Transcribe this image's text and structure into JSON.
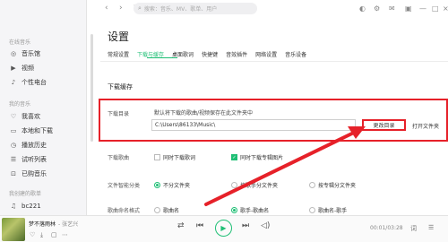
{
  "topbar": {
    "back_icon": "left-arrow-icon",
    "forward_icon": "right-arrow-icon",
    "search_placeholder": "搜索：音乐、MV、歌单、用户"
  },
  "sidebar": {
    "group_online": "在线音乐",
    "online_items": [
      {
        "label": "音乐馆",
        "icon": "music-hall-icon"
      },
      {
        "label": "视频",
        "icon": "video-icon"
      },
      {
        "label": "个性电台",
        "icon": "radio-icon"
      }
    ],
    "group_mine": "我的音乐",
    "mine_items": [
      {
        "label": "我喜欢",
        "icon": "heart-icon"
      },
      {
        "label": "本地和下载",
        "icon": "computer-icon"
      },
      {
        "label": "播放历史",
        "icon": "history-icon"
      },
      {
        "label": "试听列表",
        "icon": "playlist-icon"
      },
      {
        "label": "已购音乐",
        "icon": "bag-icon"
      }
    ],
    "group_created": "我创建的歌单",
    "created_items": [
      {
        "label": "bc221",
        "icon": "music-note-icon"
      }
    ]
  },
  "settings": {
    "title": "设置",
    "tabs": [
      "常规设置",
      "下载与缓存",
      "桌面歌词",
      "快捷键",
      "音效插件",
      "网络设置",
      "音乐设备"
    ],
    "active_tab": "下载与缓存",
    "section_title": "下载缓存",
    "download_dir_label": "下载目录",
    "download_dir_desc": "默认将下载的歌曲/视频保存在此文件夹中",
    "download_dir_path": "C:\\Users\\86133\\Music\\",
    "change_dir_button": "更改目录",
    "open_folder_button": "打开文件夹",
    "download_lyrics_label": "下载歌曲",
    "download_lyrics_opt1": "同时下载歌词",
    "download_lyrics_opt2": "同时下载专辑图片",
    "classify_label": "文件智能分类",
    "classify_options": [
      "不分文件夹",
      "按歌手分文件夹",
      "按专辑分文件夹"
    ],
    "naming_label": "歌曲命名格式",
    "naming_options": [
      "歌曲名",
      "歌手-歌曲名",
      "歌曲名-歌手"
    ]
  },
  "player": {
    "song": "梦不落雨林",
    "artist": "- 张艺兴",
    "time": "00:01/03:28"
  },
  "colors": {
    "accent": "#1fbf75",
    "highlight": "#e62129"
  }
}
